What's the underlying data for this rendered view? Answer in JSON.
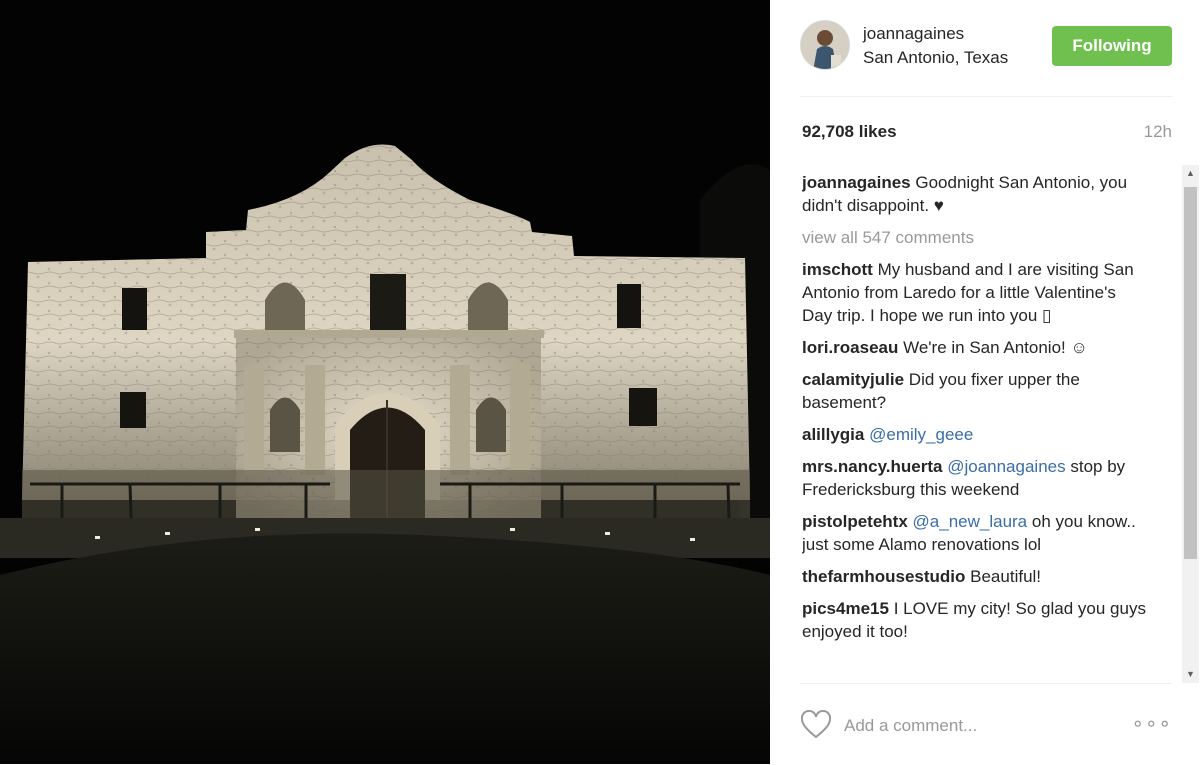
{
  "post": {
    "image_alt": "Alamo at night",
    "username": "joannagaines",
    "location": "San Antonio, Texas",
    "follow_label": "Following",
    "likes": "92,708 likes",
    "time": "12h",
    "caption": {
      "user": "joannagaines",
      "text": "Goodnight San Antonio, you didn't disappoint. ♥"
    },
    "view_all": "view all 547 comments",
    "comments": [
      {
        "user": "imschott",
        "text": "My husband and I are visiting San Antonio from Laredo for a little Valentine's Day trip. I hope we run into you ▯"
      },
      {
        "user": "lori.roaseau",
        "text": "We're in San Antonio! ☺"
      },
      {
        "user": "calamityjulie",
        "text": "Did you fixer upper the basement?"
      },
      {
        "user": "alillygia",
        "mention": "@emily_geee",
        "text": ""
      },
      {
        "user": "mrs.nancy.huerta",
        "mention": "@joannagaines",
        "text": "stop by Fredericksburg this weekend"
      },
      {
        "user": "pistolpetehtx",
        "mention": "@a_new_laura",
        "text": "oh you know.. just some Alamo renovations lol"
      },
      {
        "user": "thefarmhousestudio",
        "text": "Beautiful!"
      },
      {
        "user": "pics4me15",
        "text": "I LOVE my city! So glad you guys enjoyed it too!"
      }
    ],
    "add_comment_placeholder": "Add a comment...",
    "more_label": "∘∘∘",
    "scroll_up": "▲",
    "scroll_down": "▼"
  },
  "colors": {
    "follow": "#70c050",
    "mention": "#3a6ea5",
    "muted": "#999999"
  }
}
